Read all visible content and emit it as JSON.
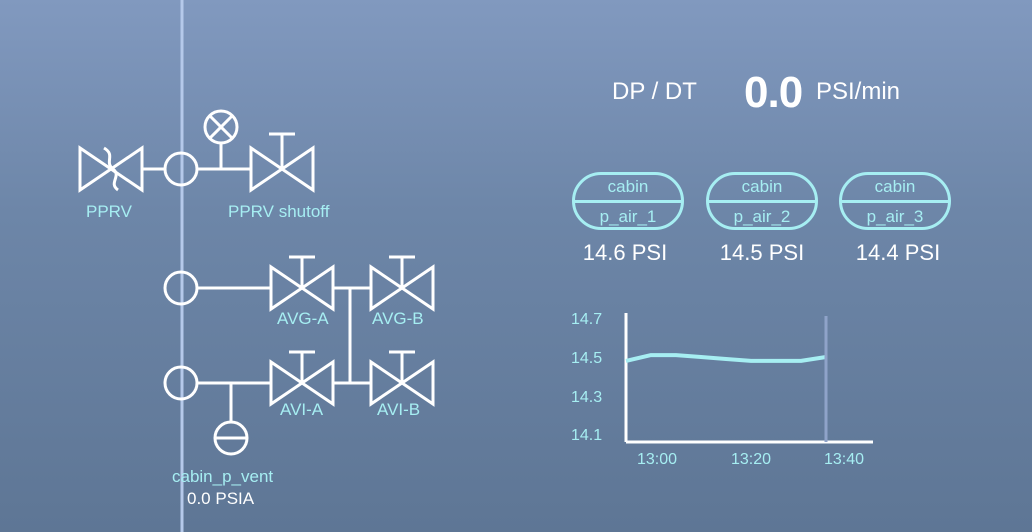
{
  "schematic": {
    "pprv_label": "PPRV",
    "pprv_shutoff_label": "PPRV shutoff",
    "avg_a_label": "AVG-A",
    "avg_b_label": "AVG-B",
    "avi_a_label": "AVI-A",
    "avi_b_label": "AVI-B",
    "vent_label": "cabin_p_vent",
    "vent_value": "0.0 PSIA"
  },
  "dpdt": {
    "label": "DP / DT",
    "value": "0.0",
    "unit": "PSI/min"
  },
  "sensors": [
    {
      "top": "cabin",
      "bottom": "p_air_1",
      "reading": "14.6 PSI"
    },
    {
      "top": "cabin",
      "bottom": "p_air_2",
      "reading": "14.5 PSI"
    },
    {
      "top": "cabin",
      "bottom": "p_air_3",
      "reading": "14.4 PSI"
    }
  ],
  "colors": {
    "accent": "#a6eef2",
    "line": "#ffffff",
    "cursor": "#8fa3c9"
  },
  "chart_data": {
    "type": "line",
    "yticks": [
      "14.7",
      "14.5",
      "14.3",
      "14.1"
    ],
    "xticks": [
      "13:00",
      "13:20",
      "13:40"
    ],
    "ylim": [
      14.1,
      14.7
    ],
    "series": [
      {
        "x_min": [
          0,
          5,
          10,
          15,
          20,
          25,
          30,
          35,
          40
        ],
        "values": [
          14.49,
          14.52,
          14.52,
          14.51,
          14.5,
          14.49,
          14.49,
          14.49,
          14.51
        ]
      }
    ],
    "cursor_x_min": 40
  }
}
